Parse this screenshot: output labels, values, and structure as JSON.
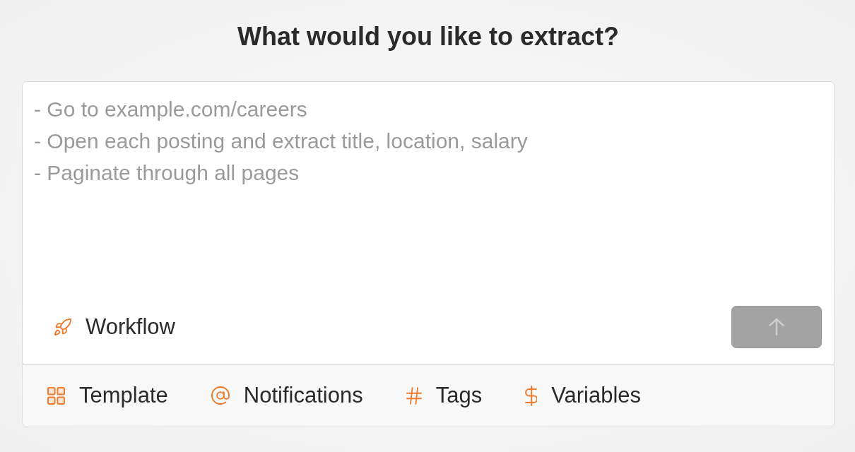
{
  "heading": {
    "title": "What would you like to extract?"
  },
  "prompt": {
    "placeholder": "- Go to example.com/careers\n- Open each posting and extract title, location, salary\n- Paginate through all pages"
  },
  "workflow_button": {
    "label": "Workflow"
  },
  "send_button": {
    "disabled": true
  },
  "toolbar": {
    "items": [
      {
        "label": "Template"
      },
      {
        "label": "Notifications"
      },
      {
        "label": "Tags"
      },
      {
        "label": "Variables"
      }
    ]
  }
}
